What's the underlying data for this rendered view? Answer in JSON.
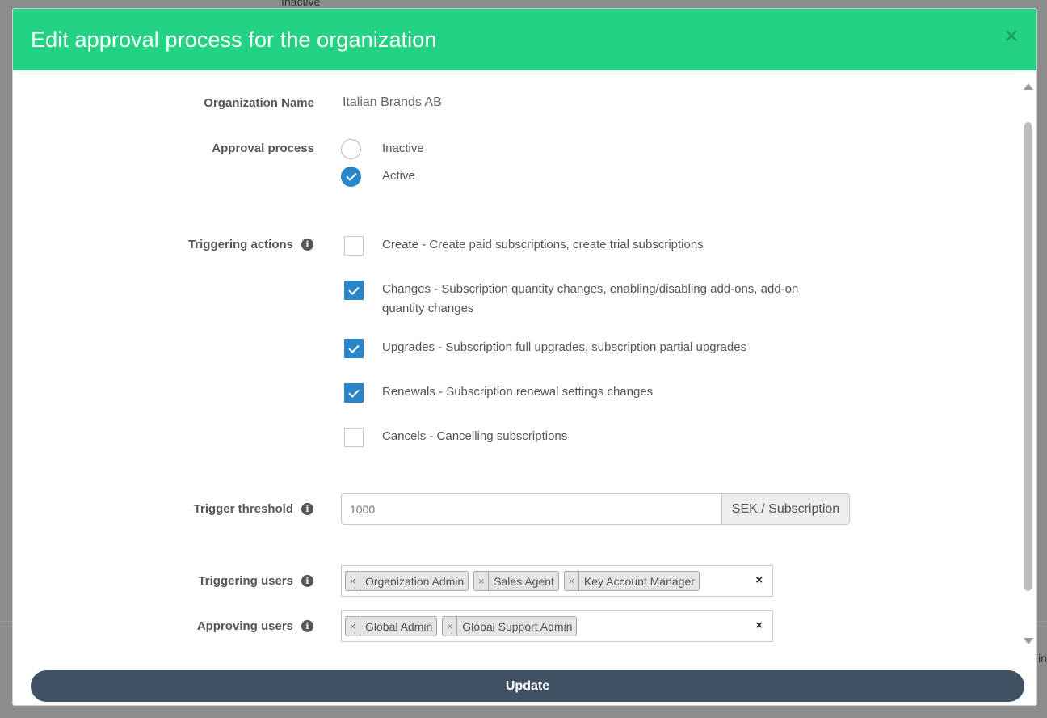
{
  "background": {
    "top_text": "Inactive",
    "right_text": "in"
  },
  "modal": {
    "title": "Edit approval process for the organization",
    "close_icon": "close-icon",
    "header_color": "#24d283"
  },
  "organization": {
    "label": "Organization Name",
    "value": "Italian Brands AB"
  },
  "approval_process": {
    "label": "Approval process",
    "options": [
      {
        "label": "Inactive",
        "selected": false
      },
      {
        "label": "Active",
        "selected": true
      }
    ]
  },
  "triggering_actions": {
    "label": "Triggering actions",
    "info_icon": "info-icon",
    "items": [
      {
        "label": "Create - Create paid subscriptions, create trial subscriptions",
        "checked": false
      },
      {
        "label": "Changes - Subscription quantity changes, enabling/disabling add-ons, add-on quantity changes",
        "checked": true
      },
      {
        "label": "Upgrades - Subscription full upgrades, subscription partial upgrades",
        "checked": true
      },
      {
        "label": "Renewals - Subscription renewal settings changes",
        "checked": true
      },
      {
        "label": "Cancels - Cancelling subscriptions",
        "checked": false
      }
    ]
  },
  "trigger_threshold": {
    "label": "Trigger threshold",
    "value": "1000",
    "unit": "SEK / Subscription"
  },
  "triggering_users": {
    "label": "Triggering users",
    "tags": [
      "Organization Admin",
      "Sales Agent",
      "Key Account Manager"
    ],
    "clear_label": "×"
  },
  "approving_users": {
    "label": "Approving users",
    "tags": [
      "Global Admin",
      "Global Support Admin"
    ],
    "clear_label": "×"
  },
  "footer": {
    "update_label": "Update",
    "button_color": "#3f5163"
  },
  "accent_color": "#2a86c9"
}
